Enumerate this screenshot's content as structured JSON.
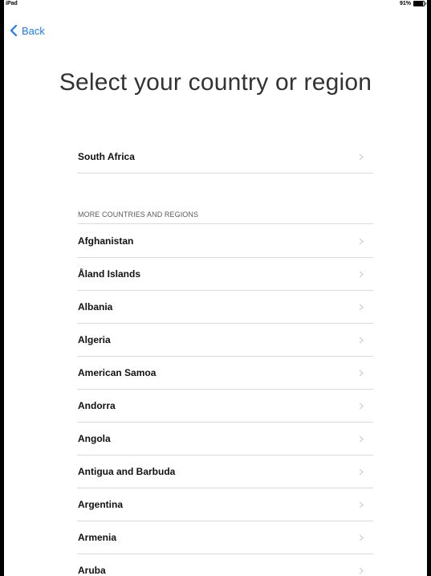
{
  "status_bar": {
    "device": "iPad",
    "battery": "91%"
  },
  "nav": {
    "back_label": "Back"
  },
  "title": "Select your country or region",
  "suggested": {
    "label": "South Africa"
  },
  "section_header": "MORE COUNTRIES AND REGIONS",
  "countries": [
    "Afghanistan",
    "Åland Islands",
    "Albania",
    "Algeria",
    "American Samoa",
    "Andorra",
    "Angola",
    "Antigua and Barbuda",
    "Argentina",
    "Armenia",
    "Aruba"
  ],
  "colors": {
    "accent": "#1a7cf6",
    "separator": "#d9d9d9",
    "chevron": "#c7c7cc"
  }
}
